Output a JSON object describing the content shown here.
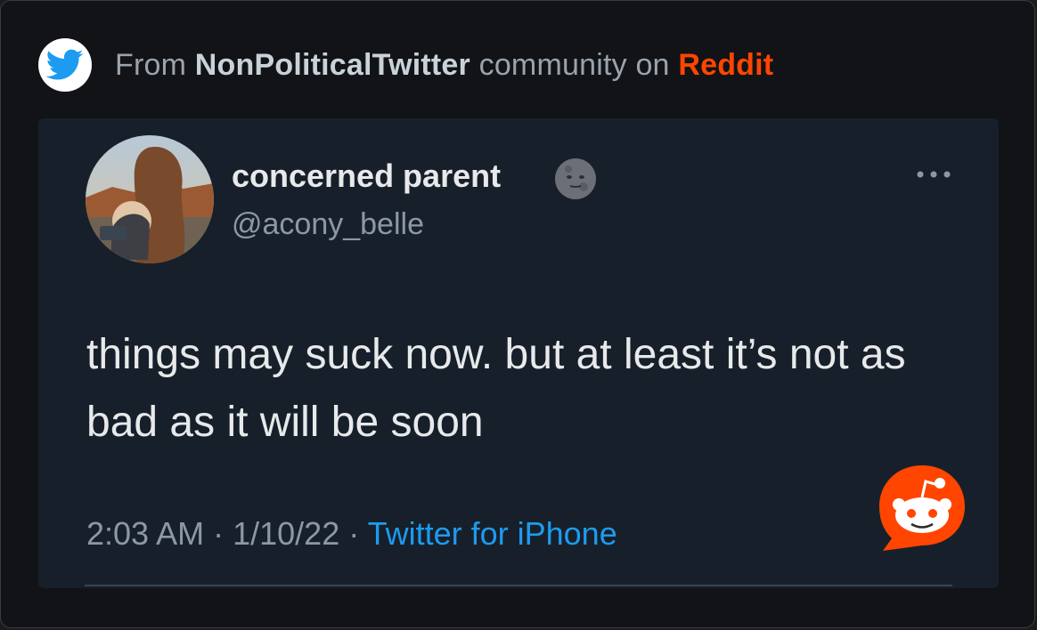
{
  "source": {
    "prefix": "From",
    "community": "NonPoliticalTwitter",
    "middle": "community on",
    "platform": "Reddit",
    "icon": "twitter-bird-icon"
  },
  "tweet": {
    "display_name": "concerned parent",
    "name_emoji": "new-moon-face-icon",
    "handle": "@acony_belle",
    "text": "things may suck now. but at least it’s not as bad as it will be soon",
    "time": "2:03 AM",
    "date": "1/10/22",
    "client": "Twitter for iPhone",
    "more_icon": "more-options-icon"
  },
  "overlay": {
    "icon": "reddit-snoo-icon"
  },
  "colors": {
    "reddit": "#ff4500",
    "twitter_blue": "#1d9bf0",
    "tweet_background": "#17202a",
    "page_background": "#111316"
  }
}
